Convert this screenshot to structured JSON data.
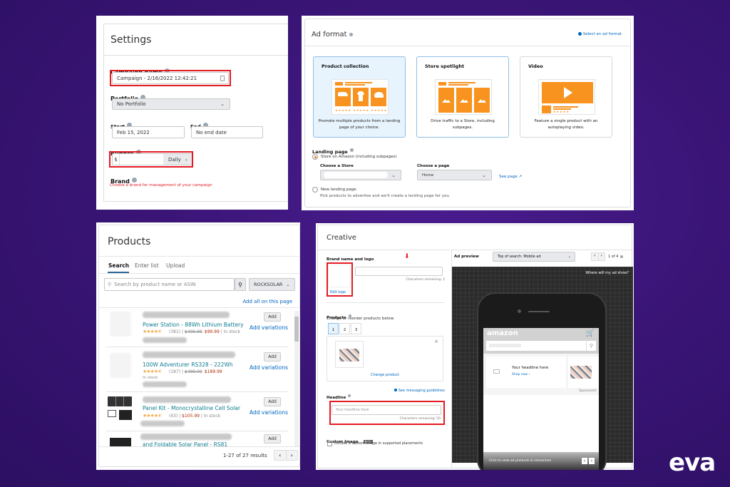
{
  "settings": {
    "title": "Settings",
    "campaign_name_label": "Campaign name",
    "campaign_name_value": "Campaign - 2/16/2022 12:42:21",
    "portfolio_label": "Portfolio",
    "portfolio_value": "No Portfolio",
    "start_label": "Start",
    "start_value": "Feb 15, 2022",
    "end_label": "End",
    "end_value": "No end date",
    "budget_label": "Budget",
    "budget_currency": "$",
    "budget_value": "",
    "budget_period": "Daily",
    "brand_label": "Brand",
    "brand_error": "Choose a brand for management of your campaign"
  },
  "ad_format": {
    "title": "Ad format",
    "help_link": "Select an ad format",
    "cards": [
      {
        "title": "Product collection",
        "desc": "Promote multiple products from a landing page of your choice.",
        "selected": true
      },
      {
        "title": "Store spotlight",
        "desc": "Drive traffic to a Store, including subpages.",
        "selected": false
      },
      {
        "title": "Video",
        "desc": "Feature a single product with an autoplaying video.",
        "selected": false
      }
    ],
    "landing_page_label": "Landing page",
    "option_store": "Store on Amazon (including subpages)",
    "choose_store_label": "Choose a Store",
    "choose_store_value": "",
    "choose_page_label": "Choose a page",
    "choose_page_value": "Home",
    "see_page_link": "See page",
    "option_new": "New landing page",
    "option_new_desc": "Pick products to advertise and we'll create a landing page for you."
  },
  "products": {
    "title": "Products",
    "tabs": [
      "Search",
      "Enter list",
      "Upload"
    ],
    "active_tab": "Search",
    "search_placeholder": "Search by product name or ASIN",
    "brand_filter": "ROCKSOLAR",
    "add_all_link": "Add all on this page",
    "add_label": "Add",
    "add_variations_label": "Add variations",
    "items": [
      {
        "name": "Power Station - 88Wh Lithium Battery",
        "reviews": "(381)",
        "list_price": "$409.99",
        "price": "$99.99",
        "stock": "In stock",
        "rating": 4.5
      },
      {
        "name": "100W Adventurer RS328 - 222Wh",
        "reviews": "(187)",
        "list_price": "$499.00",
        "price": "$189.99",
        "stock": "In stock",
        "rating": 4.5
      },
      {
        "name": "Panel Kit - Monocrystalline Cell Solar",
        "reviews": "(43)",
        "list_price": "",
        "price": "$105.99",
        "stock": "In stock",
        "rating": 4.5
      },
      {
        "name": "and Foldable Solar Panel - RS81",
        "reviews": "",
        "list_price": "",
        "price": "",
        "stock": "",
        "rating": 0
      }
    ],
    "results_text": "1-27 of 27 results"
  },
  "creative": {
    "title": "Creative",
    "brand_logo_label": "Brand name and logo",
    "brand_chars_remaining": "Characters remaining: 2",
    "edit_logo_link": "Edit logo",
    "products_label": "Products",
    "products_hint": "Change or reorder products below.",
    "product_tabs": [
      "1",
      "2",
      "3"
    ],
    "change_product_link": "Change product",
    "headline_label": "Headline",
    "guidelines_link": "See messaging guidelines",
    "headline_placeholder": "Your headline here",
    "headline_chars_remaining": "Characters remaining: 50",
    "custom_image_label": "Custom Image",
    "custom_image_badge": "Beta",
    "custom_image_checkbox": "Include a custom image in supported placements",
    "preview_label": "Ad preview",
    "preview_placement": "Top of search: Mobile ad",
    "preview_page": "1 of 4",
    "where_link": "Where will my ad show?",
    "mock_logo": "amazon",
    "mock_headline": "Your headline here",
    "mock_shop_now": "Shop now ›",
    "mock_sponsored": "Sponsored",
    "mock_footer": "Click to view ad products & interaction"
  },
  "branding": {
    "logo_text": "eva"
  }
}
